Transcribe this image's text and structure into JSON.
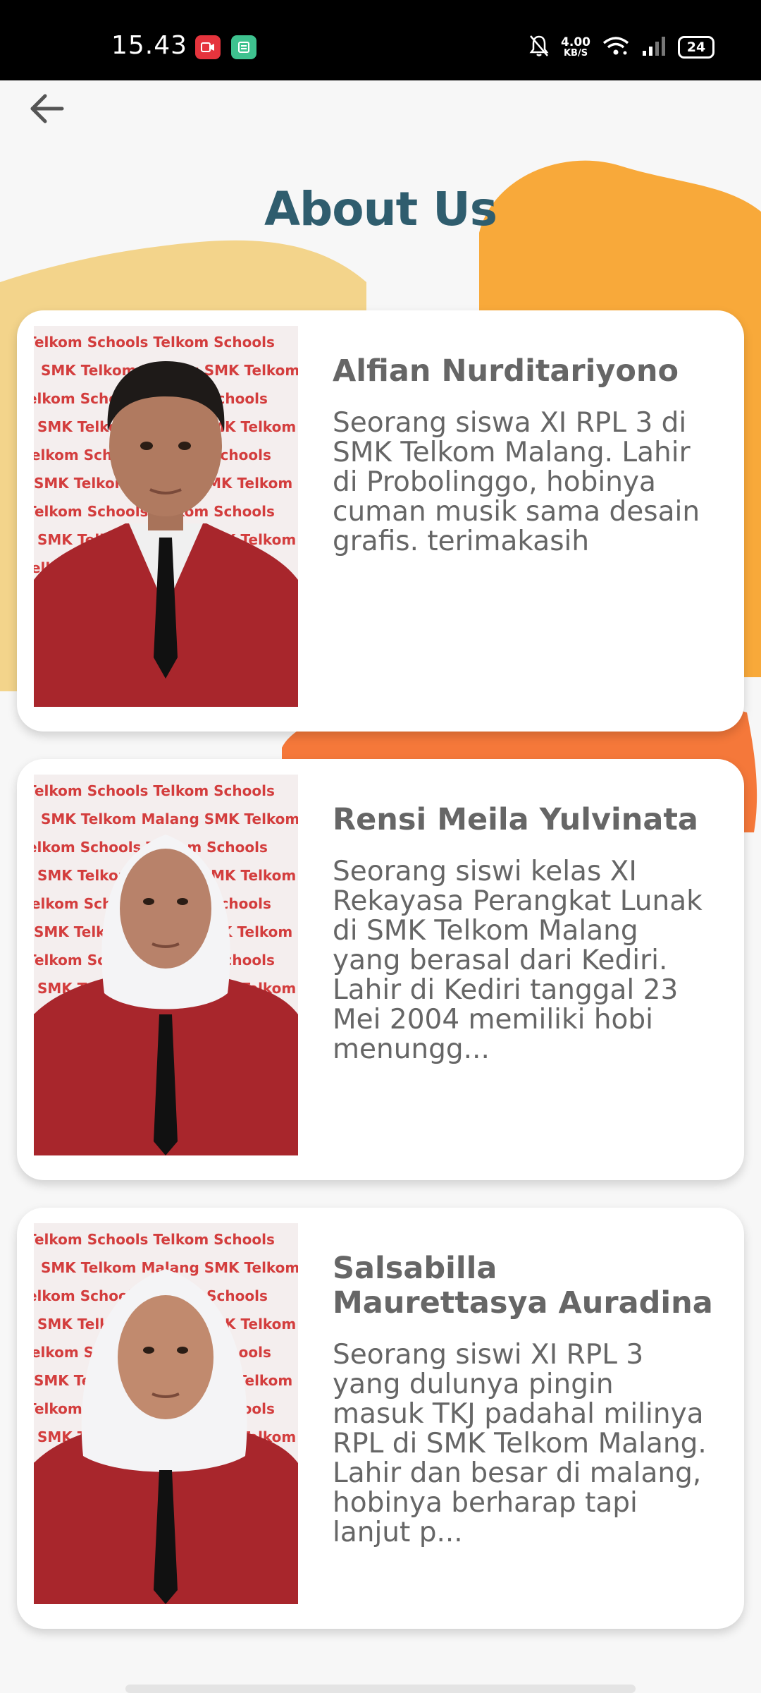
{
  "status_bar": {
    "time": "15.43",
    "speed_value": "4.00",
    "speed_unit": "KB/S",
    "battery": "24"
  },
  "page": {
    "title": "About Us"
  },
  "members": [
    {
      "name": "Alfian Nurditariyono",
      "description": "Seorang siswa XI RPL 3 di SMK Telkom Malang. Lahir di Probolinggo, hobinya cuman musik sama desain grafis. terimakasih",
      "photo_backdrop": "Telkom Schools SMK Telkom Malang"
    },
    {
      "name": "Rensi Meila Yulvinata",
      "description": "Seorang siswi kelas XI Rekayasa Perangkat Lunak di SMK Telkom Malang yang berasal dari Kediri. Lahir di Kediri tanggal 23 Mei 2004 memiliki hobi menungg...",
      "photo_backdrop": "Telkom Schools SMK Telkom Malang"
    },
    {
      "name": "Salsabilla Maurettasya Auradina",
      "description": "Seorang siswi XI RPL 3 yang dulunya pingin masuk TKJ padahal milinya RPL di SMK Telkom Malang. Lahir dan besar di malang, hobinya berharap tapi lanjut p...",
      "photo_backdrop": "Telkom Schools SMK Telkom Malang"
    }
  ],
  "colors": {
    "title": "#2f5d6e",
    "blob_yellow": "#f3d48b",
    "blob_orange": "#f8a93a",
    "blob_red_orange": "#f5783a",
    "blazer": "#a8262c"
  }
}
